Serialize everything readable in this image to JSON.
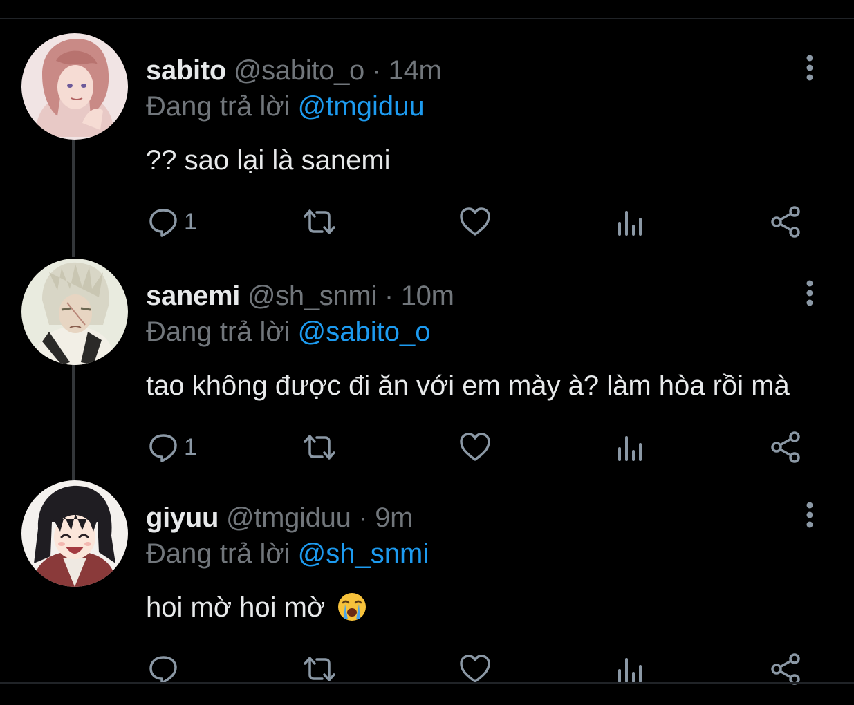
{
  "reply_prefix": "Đang trả lời",
  "dot": "·",
  "tweets": [
    {
      "name": "sabito",
      "handle": "@sabito_o",
      "time": "14m",
      "reply_to": "@tmgiduu",
      "text": "?? sao lại là sanemi",
      "reply_count": "1",
      "avatar": "sabito-avatar"
    },
    {
      "name": "sanemi",
      "handle": "@sh_snmi",
      "time": "10m",
      "reply_to": "@sabito_o",
      "text": "tao không được đi ăn với em mày à? làm hòa rồi mà",
      "reply_count": "1",
      "avatar": "sanemi-avatar"
    },
    {
      "name": "giyuu",
      "handle": "@tmgiduu",
      "time": "9m",
      "reply_to": "@sh_snmi",
      "text": "hoi mờ hoi mờ",
      "reply_count": "",
      "emoji": "loudly-crying-face",
      "avatar": "giyuu-avatar"
    }
  ],
  "icons": [
    "reply-icon",
    "retweet-icon",
    "like-icon",
    "views-icon",
    "share-icon",
    "more-icon"
  ],
  "colors": {
    "background": "#000000",
    "text": "#e7e9ea",
    "muted": "#71767b",
    "mention": "#1d9bf0",
    "line": "#333639"
  }
}
